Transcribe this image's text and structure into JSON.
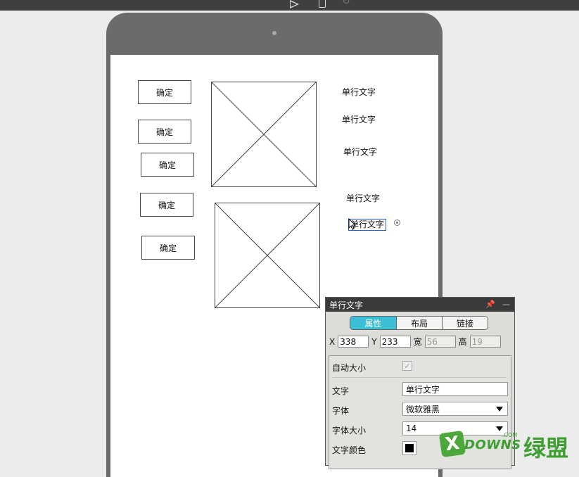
{
  "canvas": {
    "buttons": [
      "确定",
      "确定",
      "确定",
      "确定",
      "确定"
    ],
    "labels": [
      "单行文字",
      "单行文字",
      "单行文字",
      "单行文字",
      "单行文字"
    ]
  },
  "panel": {
    "title": "单行文字",
    "tabs": [
      "属性",
      "布局",
      "链接"
    ],
    "x_label": "X",
    "x_value": "338",
    "y_label": "Y",
    "y_value": "233",
    "w_label": "宽",
    "w_value": "56",
    "h_label": "高",
    "h_value": "19",
    "auto_size_label": "自动大小",
    "text_label": "文字",
    "text_value": "单行文字",
    "font_label": "字体",
    "font_value": "微软雅黑",
    "font_size_label": "字体大小",
    "font_size_value": "14",
    "color_label": "文字颜色",
    "color_value": "#000000"
  },
  "watermark": {
    "x": "X",
    "brand": "DOWNS",
    "com": ".COM",
    "cn": "绿盟"
  },
  "colors": {
    "accent_tab": "#3bbfd5",
    "device": "#6b6b6b",
    "selection": "#2a5bd7"
  }
}
